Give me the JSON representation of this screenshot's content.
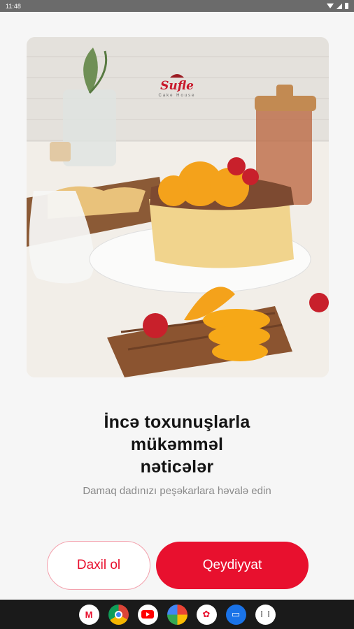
{
  "status_bar": {
    "time": "11:48",
    "icons": [
      "wifi-icon",
      "signal-icon",
      "battery-icon"
    ]
  },
  "hero": {
    "logo_text": "Sufle",
    "logo_tagline": "Cake House",
    "image": "cake-with-oranges-photo"
  },
  "onboarding": {
    "title_lines": [
      "İncə toxunuşlarla",
      "mükəmməl",
      "nəticələr"
    ],
    "subtitle": "Damaq dadınızı peşəkarlara həvalə edin"
  },
  "buttons": {
    "login_label": "Daxil ol",
    "register_label": "Qeydiyyat"
  },
  "colors": {
    "brand_red": "#e8102e",
    "background": "#f6f6f6"
  },
  "taskbar": {
    "apps": [
      "gmail-icon",
      "chrome-icon",
      "youtube-icon",
      "photos-icon",
      "app-icon",
      "messages-icon",
      "app-drawer-icon"
    ]
  }
}
